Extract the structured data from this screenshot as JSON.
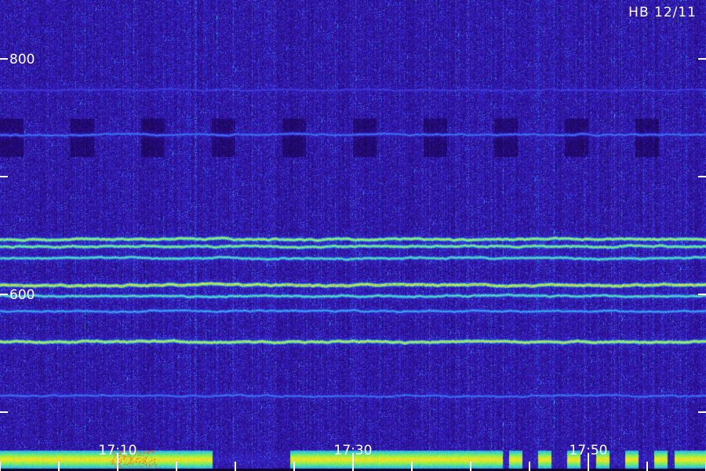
{
  "header": {
    "label": "HB 12/11"
  },
  "chart_data": {
    "type": "heatmap",
    "title": "",
    "xlabel": "",
    "ylabel": "",
    "x_ticks": [
      "17:10",
      "17:30",
      "17:50"
    ],
    "x_minor_ticks": [
      "17:00",
      "17:05",
      "17:15",
      "17:20",
      "17:25",
      "17:35",
      "17:40",
      "17:45",
      "17:55",
      "18:00"
    ],
    "y_ticks": [
      "800",
      "600"
    ],
    "y_unlabeled_ticks": [
      700,
      500
    ],
    "ylim": [
      450,
      850
    ],
    "xlim": [
      "17:00",
      "18:00"
    ],
    "colormap": [
      "#08021e",
      "#2a0c8e",
      "#3c2cd8",
      "#2f8ef0",
      "#3ad6c8",
      "#9cf03c",
      "#ffe428",
      "#ff3a10"
    ],
    "background_color": "#0a0330",
    "features": [
      {
        "name": "",
        "y": 774,
        "intensity": 0.35
      },
      {
        "name": "",
        "y": 736,
        "intensity": 0.45
      },
      {
        "name": "",
        "y": 647,
        "intensity": 0.85
      },
      {
        "name": "",
        "y": 641,
        "intensity": 0.8
      },
      {
        "name": "",
        "y": 631,
        "intensity": 0.7
      },
      {
        "name": "",
        "y": 608,
        "intensity": 0.95
      },
      {
        "name": "",
        "y": 599,
        "intensity": 0.7
      },
      {
        "name": "",
        "y": 586,
        "intensity": 0.55
      },
      {
        "name": "",
        "y": 560,
        "intensity": 0.9
      },
      {
        "name": "",
        "y": 514,
        "intensity": 0.45
      }
    ]
  }
}
